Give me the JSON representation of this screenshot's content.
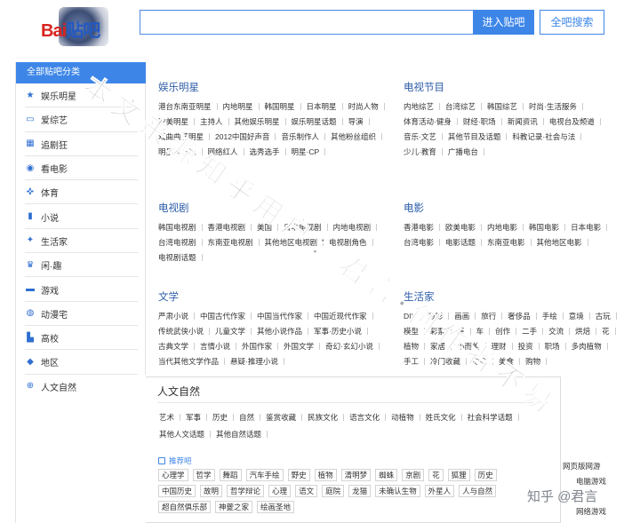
{
  "header": {
    "logo_text_a": "Bai",
    "logo_text_b": "贴吧",
    "search_placeholder": "",
    "enter_button": "进入贴吧",
    "all_search_button": "全吧搜索"
  },
  "sidebar": {
    "title": "全部贴吧分类",
    "items": [
      {
        "label": "娱乐明星",
        "icon": "star-icon",
        "glyph": "★"
      },
      {
        "label": "爱综艺",
        "icon": "tv-icon",
        "glyph": "▭"
      },
      {
        "label": "追剧狂",
        "icon": "film-icon",
        "glyph": "▦"
      },
      {
        "label": "看电影",
        "icon": "camera-icon",
        "glyph": "◉"
      },
      {
        "label": "体育",
        "icon": "sport-icon",
        "glyph": "✜"
      },
      {
        "label": "小说",
        "icon": "book-icon",
        "glyph": "▮"
      },
      {
        "label": "生活家",
        "icon": "leaf-icon",
        "glyph": "✦"
      },
      {
        "label": "闲·趣",
        "icon": "cat-icon",
        "glyph": "♛"
      },
      {
        "label": "游戏",
        "icon": "gamepad-icon",
        "glyph": "▬"
      },
      {
        "label": "动漫宅",
        "icon": "anime-icon",
        "glyph": "◍"
      },
      {
        "label": "高校",
        "icon": "school-icon",
        "glyph": "▙"
      },
      {
        "label": "地区",
        "icon": "map-pin-icon",
        "glyph": "◆"
      },
      {
        "label": "人文自然",
        "icon": "globe-icon",
        "glyph": "⊕"
      }
    ]
  },
  "categories": [
    {
      "title": "娱乐明星",
      "tags": [
        "港台东南亚明星",
        "内地明星",
        "韩国明星",
        "日本明星",
        "时尚人物",
        "欧美明星",
        "主持人",
        "其他娱乐明星",
        "娱乐明星话题",
        "导演",
        "戏曲曲艺明星",
        "2012中国好声音",
        "音乐制作人",
        "其他粉丝组织",
        "明星官方吧",
        "网络红人",
        "选秀选手",
        "明星·CP"
      ]
    },
    {
      "title": "电视节目",
      "tags": [
        "内地综艺",
        "台湾综艺",
        "韩国综艺",
        "时尚·生活服务",
        "体育活动·健身",
        "财经·职场",
        "新闻资讯",
        "电视台及频道",
        "音乐·文艺",
        "其他节目及话题",
        "科教记录·社会与法",
        "少儿·教育",
        "广播电台"
      ]
    },
    {
      "title": "电视剧",
      "tags": [
        "韩国电视剧",
        "香港电视剧",
        "美国",
        "日本电视剧",
        "内地电视剧",
        "台湾电视剧",
        "东南亚电视剧",
        "其他地区电视剧",
        "电视剧角色",
        "电视剧话题"
      ]
    },
    {
      "title": "电影",
      "tags": [
        "香港电影",
        "欧美电影",
        "内地电影",
        "韩国电影",
        "日本电影",
        "台湾电影",
        "电影话题",
        "东南亚电影",
        "其他地区电影"
      ]
    },
    {
      "title": "文学",
      "tags": [
        "严肃小说",
        "中国古代作家",
        "中国当代作家",
        "中国近现代作家",
        "传统武侠小说",
        "儿童文学",
        "其他小说作品",
        "军事·历史小说",
        "古典文学",
        "言情小说",
        "外国作家",
        "外国文学",
        "奇幻·玄幻小说",
        "当代其他文学作品",
        "悬疑·推理小说"
      ]
    },
    {
      "title": "生活家",
      "tags": [
        "DIY",
        "摄影",
        "画画",
        "旅行",
        "奢侈品",
        "手绘",
        "意境",
        "古玩",
        "模型",
        "彩票",
        "茶",
        "车",
        "创作",
        "二手",
        "交流",
        "烘焙",
        "花",
        "植物",
        "家居",
        "小而美",
        "理财",
        "投资",
        "职场",
        "多肉植物",
        "手工",
        "冷门收藏",
        "甜品",
        "美食",
        "购物"
      ]
    }
  ],
  "panel": {
    "title": "人文自然",
    "tags": [
      "艺术",
      "军事",
      "历史",
      "自然",
      "鉴赏收藏",
      "民族文化",
      "语言文化",
      "动植物",
      "姓氏文化",
      "社会科学话题",
      "其他人文话题",
      "其他自然话题"
    ],
    "recommend_label": "推荐吧",
    "recommend_tags": [
      "心理学",
      "哲学",
      "舞蹈",
      "汽车手绘",
      "野史",
      "植物",
      "清明梦",
      "蜘蛛",
      "京剧",
      "花",
      "狐狸",
      "历史",
      "中国历史",
      "故明",
      "哲学辩论",
      "心理",
      "语文",
      "庭院",
      "龙猫",
      "未确认生物",
      "外星人",
      "人与自然",
      "超自然俱乐部",
      "神夔之家",
      "绘画圣地"
    ]
  },
  "fragments": {
    "link_a": "网页版网游",
    "link_b": "电脑游戏",
    "link_c": "网络游戏"
  },
  "watermark": {
    "text": "本文来源知乎用户：君言·创作者不易",
    "zhihu": "知乎 @君言"
  }
}
